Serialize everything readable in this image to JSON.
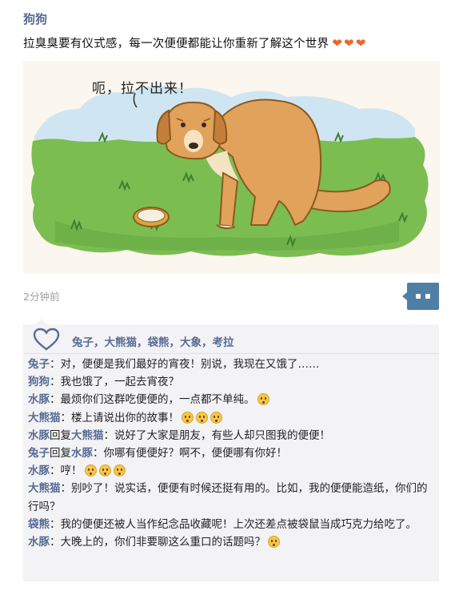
{
  "post": {
    "author": "狗狗",
    "text": "拉臭臭要有仪式感，每一次便便都能让你重新了解这个世界",
    "hearts": [
      "❤",
      "❤",
      "❤"
    ],
    "image_caption": "呃，拉不出来！",
    "time": "2分钟前"
  },
  "likes": {
    "icon": "heart-outline-icon",
    "names": "兔子，大熊猫，袋熊，大象，考拉"
  },
  "comments": [
    {
      "name": "兔子",
      "text": "：对，便便是我们最好的宵夜！别说，我现在又饿了……",
      "emoji_count": 0
    },
    {
      "name": "狗狗",
      "text": "：我也饿了，一起去宵夜？",
      "emoji_count": 0
    },
    {
      "name": "水豚",
      "text": "：最烦你们这群吃便便的，一点都不单纯。",
      "emoji_count": 1
    },
    {
      "name": "大熊猫",
      "text": "：楼上请说出你的故事！",
      "emoji_count": 3
    },
    {
      "name": "水豚",
      "reply_word": "回复",
      "reply_to": "大熊猫",
      "text": "：说好了大家是朋友，有些人却只图我的便便！",
      "emoji_count": 0
    },
    {
      "name": "兔子",
      "reply_word": "回复",
      "reply_to": "水豚",
      "text": "：你哪有便便好？啊不，便便哪有你好！",
      "emoji_count": 0
    },
    {
      "name": "水豚",
      "text": "：哼！",
      "emoji_count": 3
    },
    {
      "name": "大熊猫",
      "text": "：别吵了！说实话，便便有时候还挺有用的。比如，我的便便能造纸，你们的行吗？",
      "emoji_count": 0
    },
    {
      "name": "袋熊",
      "text": "：我的便便还被人当作纪念品收藏呢！上次还差点被袋鼠当成巧克力给吃了。",
      "emoji_count": 0
    },
    {
      "name": "水豚",
      "text": "：大晚上的，你们非要聊这么重口的话题吗？",
      "emoji_count": 1
    }
  ],
  "colors": {
    "name_blue": "#576b95",
    "comment_bg": "#f3f3f5",
    "more_button": "#4f7fa5",
    "heart": "#f0652a",
    "grass": "#6fb34b",
    "dog": "#e1a25b"
  }
}
